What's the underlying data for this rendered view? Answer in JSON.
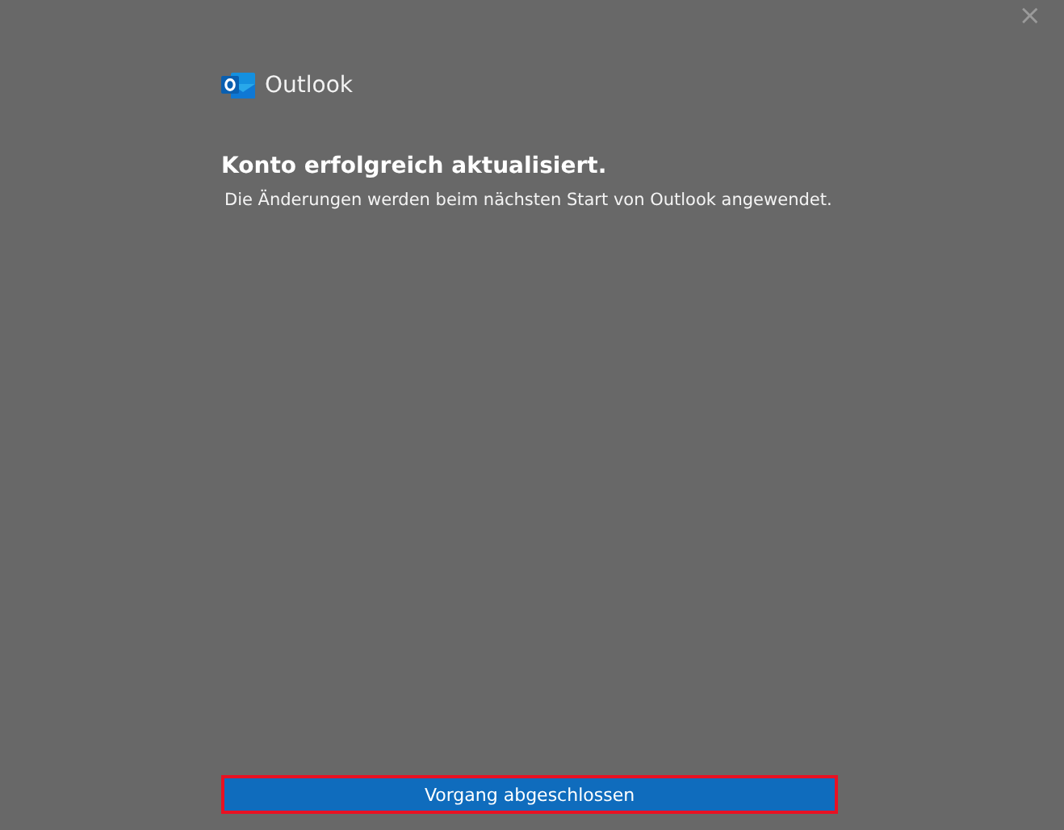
{
  "window": {
    "close": "×"
  },
  "app": {
    "name": "Outlook"
  },
  "heading": "Konto erfolgreich aktualisiert.",
  "message": "Die Änderungen werden beim nächsten Start von Outlook angewendet.",
  "button": {
    "label": "Vorgang abgeschlossen",
    "highlighted": true
  }
}
